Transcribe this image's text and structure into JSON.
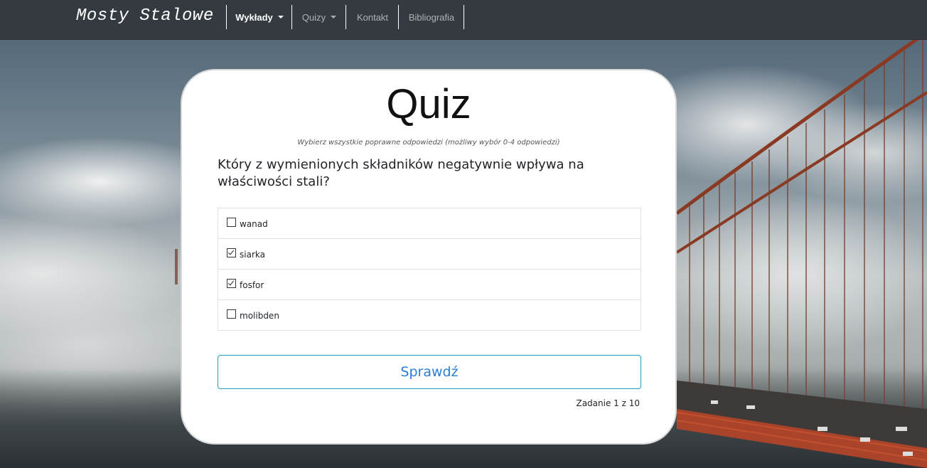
{
  "navbar": {
    "brand": "Mosty Stalowe",
    "items": [
      {
        "label": "Wykłady",
        "dropdown": true,
        "active": true
      },
      {
        "label": "Quizy",
        "dropdown": true,
        "active": false
      },
      {
        "label": "Kontakt",
        "dropdown": false,
        "active": false
      },
      {
        "label": "Bibliografia",
        "dropdown": false,
        "active": false
      }
    ]
  },
  "quiz": {
    "title": "Quiz",
    "instruction": "Wybierz wszystkie poprawne odpowiedzi (możliwy wybór 0-4 odpowiedzi)",
    "question": "Który z wymienionych składników negatywnie wpływa na właściwości stali?",
    "options": [
      {
        "label": "wanad",
        "checked": false
      },
      {
        "label": "siarka",
        "checked": true
      },
      {
        "label": "fosfor",
        "checked": true
      },
      {
        "label": "molibden",
        "checked": false
      }
    ],
    "submit_label": "Sprawdź",
    "progress": "Zadanie 1 z 10"
  },
  "colors": {
    "navbar_bg": "#343a40",
    "button_border": "#17a2b8",
    "button_text": "#2a7fd4",
    "bridge": "#b24a2a"
  },
  "background": {
    "description_icon": "golden-gate-bridge-fog-photo"
  }
}
